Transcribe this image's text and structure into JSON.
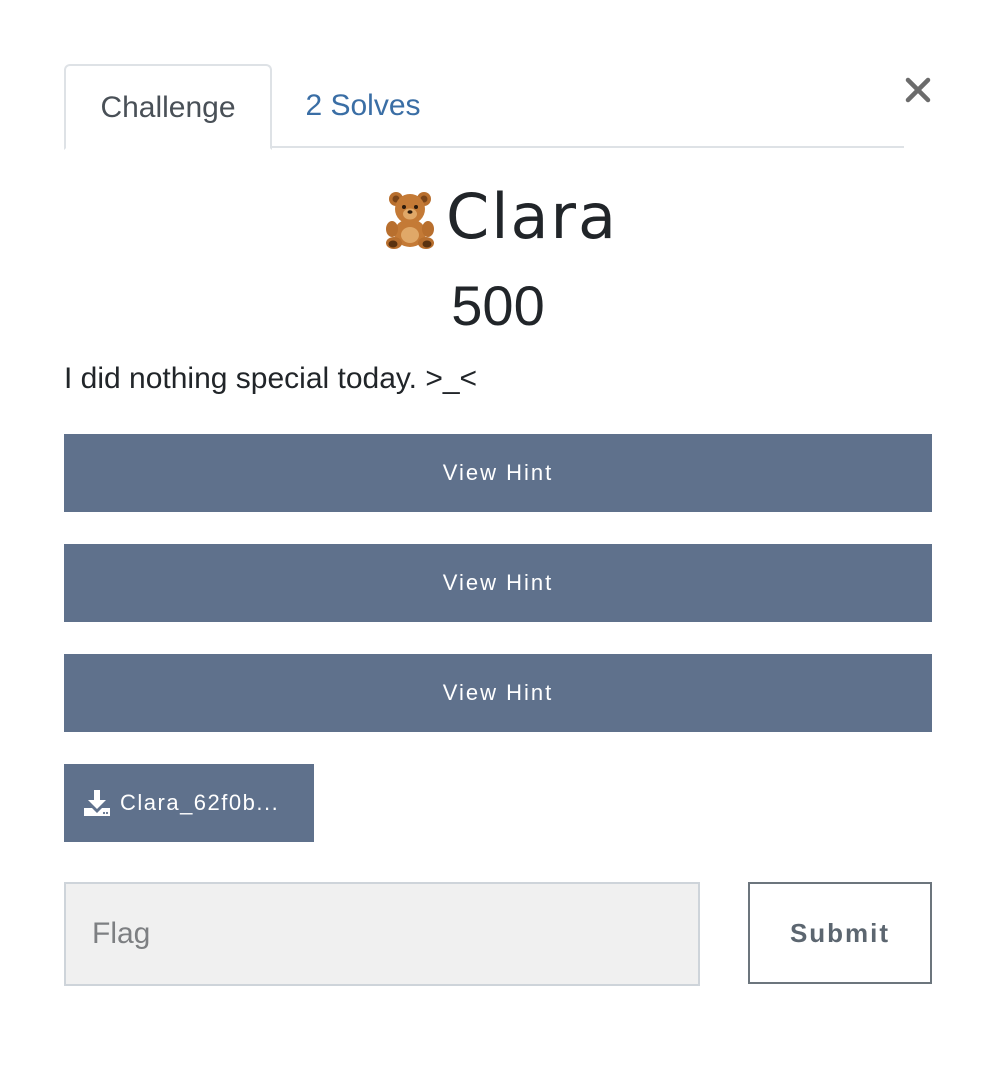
{
  "tabs": [
    {
      "label": "Challenge",
      "active": true
    },
    {
      "label": "2 Solves",
      "active": false
    }
  ],
  "close": {
    "icon": "close-icon",
    "glyph": "×"
  },
  "challenge": {
    "icon": "teddy-bear-icon",
    "name": "Clara",
    "points": "500",
    "description": "I did nothing special today. >_<"
  },
  "hints": [
    {
      "label": "View Hint"
    },
    {
      "label": "View Hint"
    },
    {
      "label": "View Hint"
    }
  ],
  "file": {
    "icon": "download-icon",
    "label": "Clara_62f0b..."
  },
  "submission": {
    "placeholder": "Flag",
    "value": "",
    "submit_label": "Submit"
  },
  "colors": {
    "button_bg": "#5f718c",
    "tab_link": "#3a6ea5",
    "input_bg": "#f0f0f0"
  }
}
